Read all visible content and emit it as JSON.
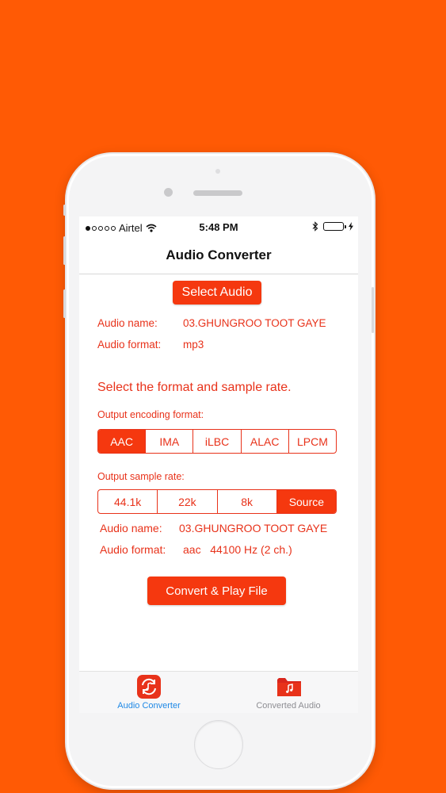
{
  "status_bar": {
    "carrier": "Airtel",
    "time": "5:48 PM"
  },
  "nav": {
    "title": "Audio Converter"
  },
  "select_button": "Select Audio",
  "source_info": {
    "name_label": "Audio name:",
    "name_value": "03.GHUNGROO TOOT GAYE",
    "format_label": "Audio format:",
    "format_value": "mp3"
  },
  "instruction": "Select the format and sample rate.",
  "encoding": {
    "label": "Output encoding format:",
    "options": [
      "AAC",
      "IMA",
      "iLBC",
      "ALAC",
      "LPCM"
    ],
    "selected": "AAC"
  },
  "sample_rate": {
    "label": "Output sample rate:",
    "options": [
      "44.1k",
      "22k",
      "8k",
      "Source"
    ],
    "selected": "Source"
  },
  "output_info": {
    "name_label": "Audio name:",
    "name_value": "03.GHUNGROO TOOT GAYE",
    "format_label": "Audio format:",
    "format_value": "aac   44100 Hz (2 ch.)"
  },
  "convert_button": "Convert & Play File",
  "tabs": [
    {
      "label": "Audio Converter",
      "icon": "audio-convert-icon",
      "active": true
    },
    {
      "label": "Converted Audio",
      "icon": "music-folder-icon",
      "active": false
    }
  ],
  "colors": {
    "background": "#FF5A05",
    "accent": "#F5380F",
    "accent_text": "#E8321A",
    "tab_active": "#1E88E5",
    "tab_inactive": "#8E8E93"
  }
}
